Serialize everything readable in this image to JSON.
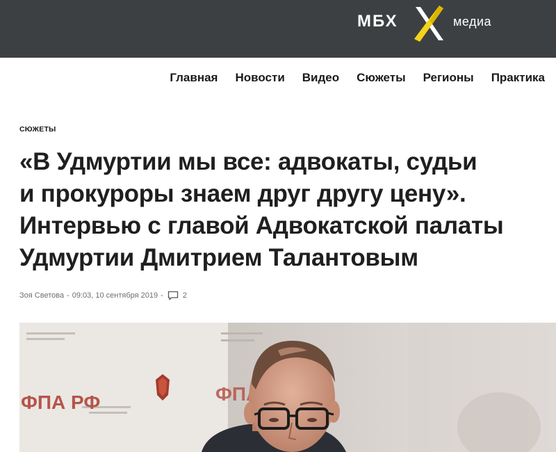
{
  "header": {
    "logo": {
      "left": "МБХ",
      "right": "медиа"
    },
    "nav": [
      "Главная",
      "Новости",
      "Видео",
      "Сюжеты",
      "Регионы",
      "Практика"
    ]
  },
  "article": {
    "section": "СЮЖЕТЫ",
    "title_lines": [
      "«В Удмуртии мы все: адвокаты, судьи",
      "и прокуроры знаем друг другу цену».",
      "Интервью с главой Адвокатской палаты",
      "Удмуртии Дмитрием Талантовым"
    ],
    "author": "Зоя Светова",
    "sep1": "-",
    "datetime": "09:03, 10 сентября 2019",
    "sep2": "-",
    "comments_count": "2",
    "photo_banner_text": "ФПА РФ",
    "photo_banner_text2": "ФПА"
  },
  "colors": {
    "topbar": "#3d4043",
    "logo_accent": "#f5d31a"
  },
  "icons": {
    "comments": "comment-icon",
    "logo_mark": "logo-x-icon"
  }
}
